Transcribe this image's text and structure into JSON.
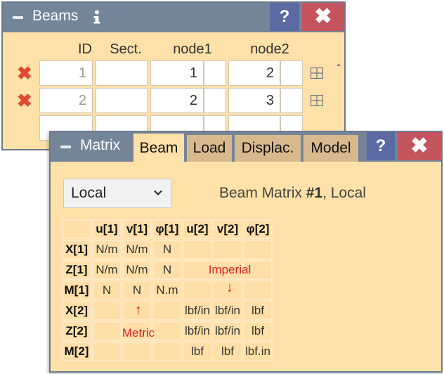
{
  "beams_window": {
    "title": "Beams",
    "info_icon": "info-icon",
    "help_label": "?",
    "close_label": "✖",
    "headers": {
      "id": "ID",
      "sect": "Sect.",
      "node1": "node1",
      "node2": "node2"
    },
    "rows": [
      {
        "id": "1",
        "sect": "",
        "node1": "1",
        "node2": "2"
      },
      {
        "id": "2",
        "sect": "",
        "node1": "2",
        "node2": "3"
      }
    ]
  },
  "matrix_window": {
    "title": "Matrix",
    "tabs": [
      {
        "label": "Beam",
        "active": true
      },
      {
        "label": "Load",
        "active": false
      },
      {
        "label": "Displac.",
        "active": false
      },
      {
        "label": "Model",
        "active": false
      }
    ],
    "help_label": "?",
    "close_label": "✖",
    "frame_select": {
      "value": "Local"
    },
    "matrix_title": {
      "prefix": "Beam Matrix ",
      "number": "#1",
      "suffix": ", Local"
    },
    "col_headers": [
      "u[1]",
      "v[1]",
      "φ[1]",
      "u[2]",
      "v[2]",
      "φ[2]"
    ],
    "row_headers": [
      "X[1]",
      "Z[1]",
      "M[1]",
      "X[2]",
      "Z[2]",
      "M[2]"
    ],
    "cells": [
      [
        "N/m",
        "N/m",
        "N",
        "",
        "",
        ""
      ],
      [
        "N/m",
        "N/m",
        "N",
        "",
        "",
        ""
      ],
      [
        "N",
        "N",
        "N.m",
        "",
        "",
        ""
      ],
      [
        "",
        "",
        "",
        "lbf/in",
        "lbf/in",
        "lbf"
      ],
      [
        "",
        "",
        "",
        "lbf/in",
        "lbf/in",
        "lbf"
      ],
      [
        "",
        "",
        "",
        "lbf",
        "lbf",
        "lbf.in"
      ]
    ],
    "annotations": {
      "imperial": "Imperial",
      "imperial_arrow": "↓",
      "metric": "Metric",
      "metric_arrow": "↑"
    }
  },
  "colors": {
    "panel_bg": "#fde1a9",
    "titlebar": "#74859a",
    "help_btn": "#5c6aa4",
    "close_btn": "#c4555f",
    "delete_icon": "#e24a2f",
    "annotation_red": "#e02020"
  }
}
